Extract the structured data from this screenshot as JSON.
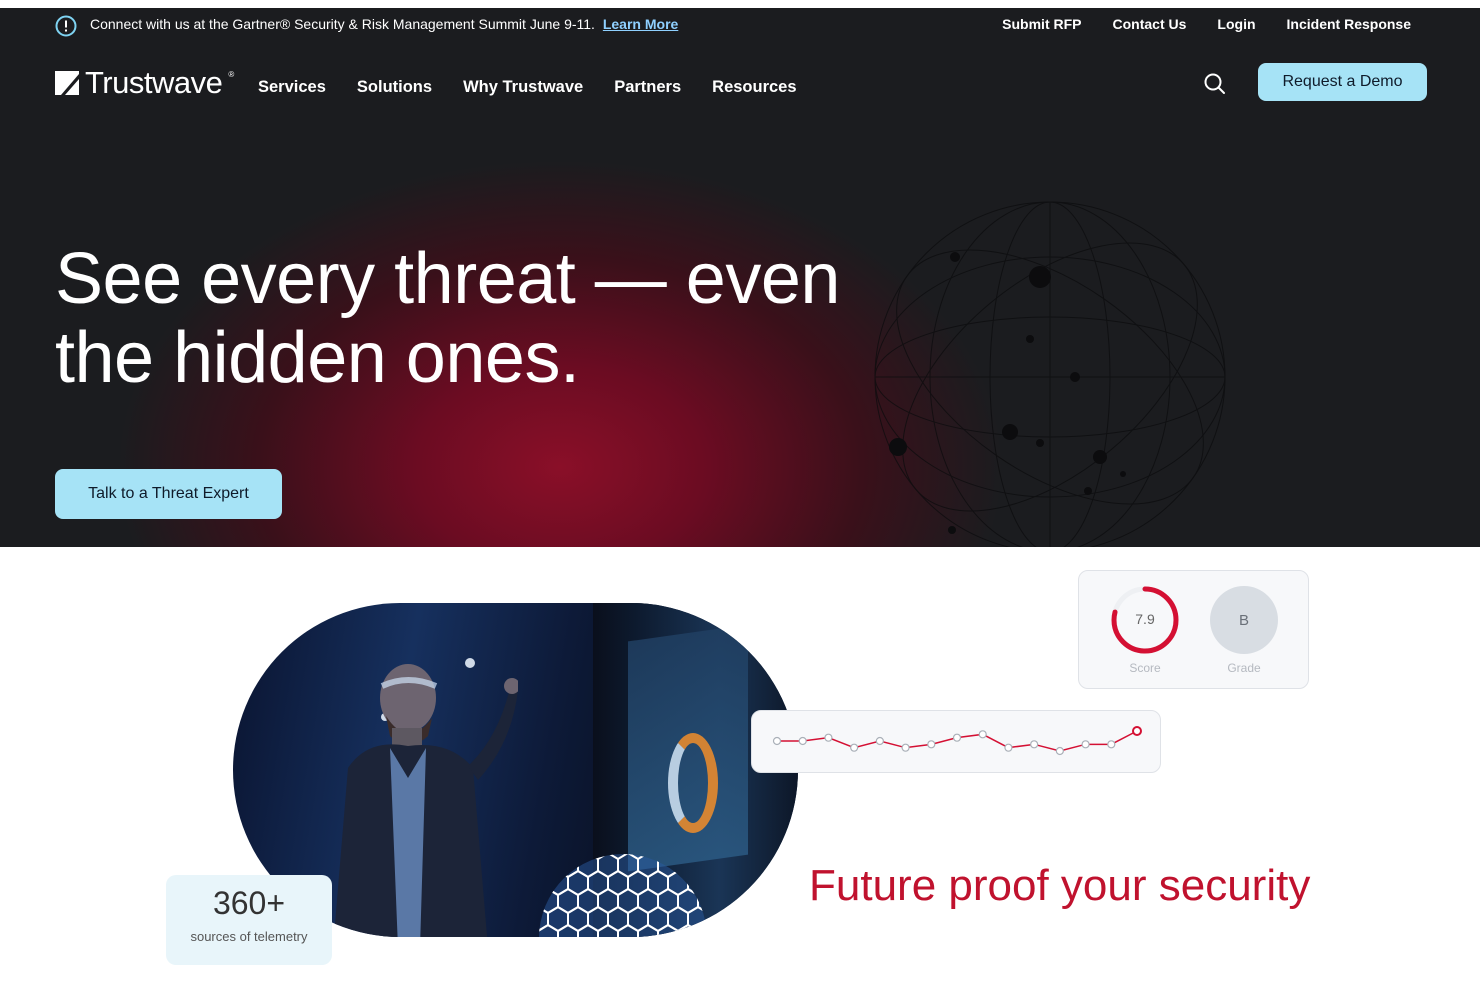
{
  "announcement": {
    "icon": "alert-circle-icon",
    "message": "Connect with us at the Gartner® Security & Risk Management Summit June 9-11.",
    "link_label": "Learn More"
  },
  "utility_links": [
    "Submit RFP",
    "Contact Us",
    "Login",
    "Incident Response"
  ],
  "brand": {
    "name": "Trustwave",
    "reg": "®"
  },
  "main_nav": [
    "Services",
    "Solutions",
    "Why Trustwave",
    "Partners",
    "Resources"
  ],
  "header": {
    "search_icon": "search-icon",
    "cta_label": "Request a Demo",
    "cta_color": "#a6e3f6"
  },
  "hero": {
    "headline_line1": "See every threat — even",
    "headline_line2": "the hidden ones.",
    "cta_label": "Talk to a Threat Expert",
    "accent_color": "#8a0f28"
  },
  "stats": {
    "telemetry_value": "360+",
    "telemetry_label": "sources of telemetry"
  },
  "score_card": {
    "score_value": "7.9",
    "score_label": "Score",
    "score_fraction": 0.79,
    "grade_value": "B",
    "grade_label": "Grade",
    "ring_color": "#d41033"
  },
  "trend_card": {
    "points": [
      5,
      5,
      6,
      3,
      5,
      3,
      4,
      6,
      7,
      3,
      4,
      2,
      4,
      4,
      8
    ],
    "line_color": "#d41033"
  },
  "tagline": "Future proof your security"
}
